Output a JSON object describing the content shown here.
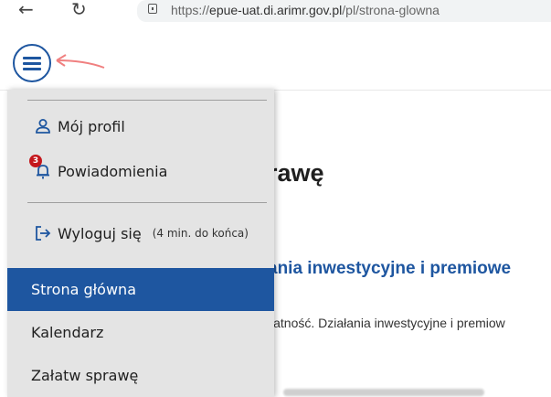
{
  "browser": {
    "url_host": "epue-uat.di.arimr.gov.pl",
    "url_path": "/pl/strona-glowna"
  },
  "page": {
    "heading_fragment": "rawę",
    "link_fragment": "ania inwestycyjne i premiowe",
    "desc_fragment": "łatność. Działania inwestycyjne i premiow"
  },
  "menu": {
    "profile_label": "Mój profil",
    "notifications_label": "Powiadomienia",
    "notifications_count": "3",
    "logout_label": "Wyloguj się",
    "logout_timer": "(4 min. do końca)",
    "nav_items": [
      {
        "label": "Strona główna",
        "active": true
      },
      {
        "label": "Kalendarz",
        "active": false
      },
      {
        "label": "Załatw sprawę",
        "active": false
      }
    ]
  },
  "colors": {
    "accent": "#1e56a0",
    "badge": "#c4161c",
    "menu_bg": "#e4e4e4",
    "annotation_arrow": "#f08080"
  }
}
